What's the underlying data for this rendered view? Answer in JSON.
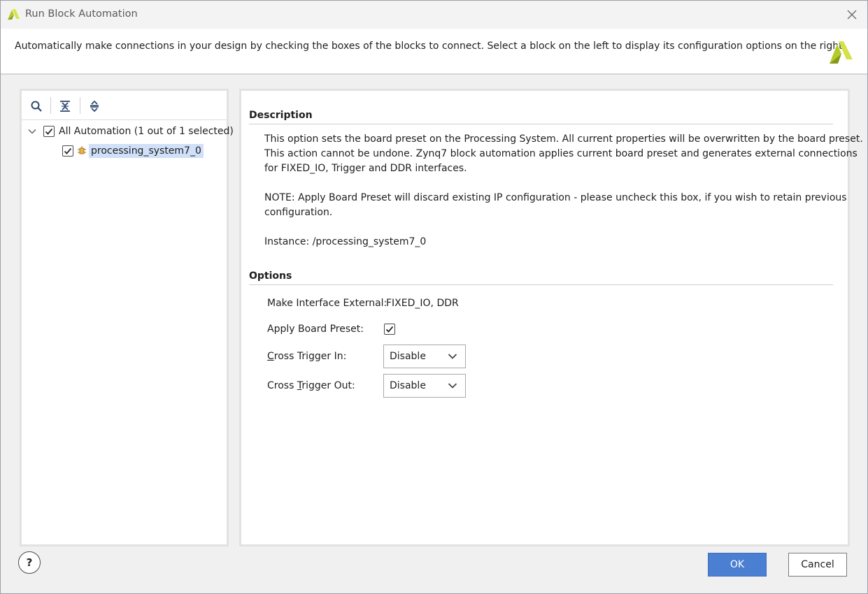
{
  "window": {
    "title": "Run Block Automation",
    "close_icon": "close-icon"
  },
  "banner": {
    "text": "Automatically make connections in your design by checking the boxes of the blocks to connect. Select a block on the left to display its configuration options on the right."
  },
  "tree": {
    "toolbar": [
      {
        "icon": "search-icon"
      },
      {
        "icon": "collapse-all-icon"
      },
      {
        "icon": "expand-all-icon"
      }
    ],
    "root": {
      "label": "All Automation (1 out of 1 selected)",
      "checked": true,
      "expanded": true
    },
    "children": [
      {
        "label": "processing_system7_0",
        "checked": true,
        "selected": true,
        "icon": "ip-block-icon"
      }
    ]
  },
  "description": {
    "heading": "Description",
    "lines": [
      "This option sets the board preset on the Processing System. All current properties will be overwritten by the board preset.",
      "This action cannot be undone. Zynq7 block automation applies current board preset and generates external connections",
      "for FIXED_IO, Trigger and DDR interfaces.",
      "NOTE: Apply Board Preset will discard existing IP configuration - please uncheck this box, if you wish to retain previous",
      "configuration.",
      "Instance: /processing_system7_0"
    ]
  },
  "options": {
    "heading": "Options",
    "make_interface_external_label": "Make Interface External:",
    "make_interface_external_value": "FIXED_IO, DDR",
    "apply_board_preset_label": "Apply Board Preset:",
    "apply_board_preset_checked": true,
    "cross_trigger_in_label_first": "C",
    "cross_trigger_in_label_rest": "ross Trigger In:",
    "cross_trigger_in_value": "Disable",
    "cross_trigger_out_label_first": "Cross ",
    "cross_trigger_out_label_mnemonic": "T",
    "cross_trigger_out_label_rest": "rigger Out:",
    "cross_trigger_out_value": "Disable"
  },
  "footer": {
    "help_label": "?",
    "ok_label": "OK",
    "cancel_label": "Cancel"
  },
  "colors": {
    "accent": "#4a7fd1",
    "selection": "#cfe0f8",
    "logo": "#c3d82a"
  }
}
